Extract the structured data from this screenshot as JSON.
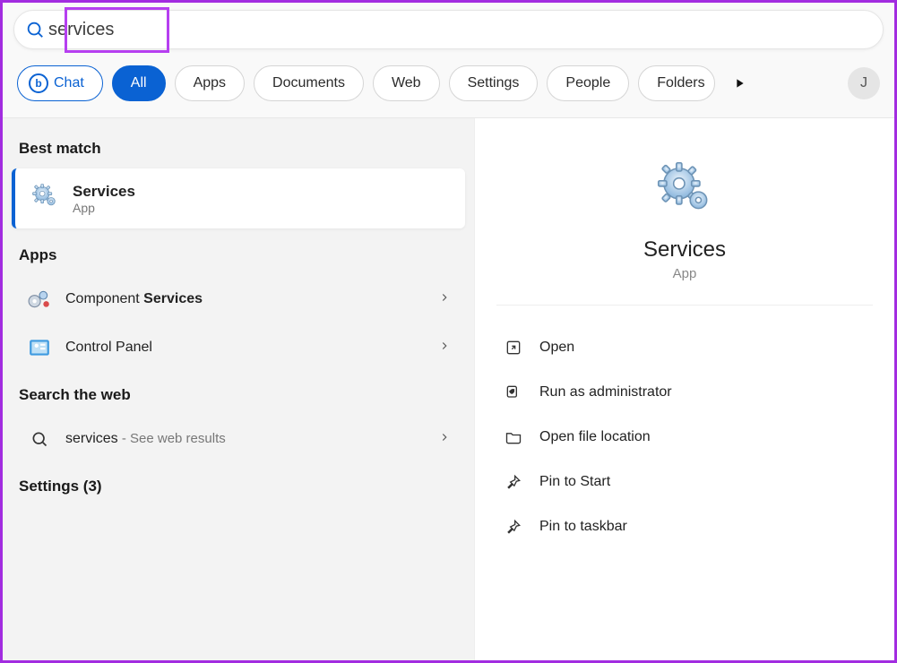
{
  "search": {
    "value": "services"
  },
  "filters": {
    "chat": "Chat",
    "all": "All",
    "apps": "Apps",
    "documents": "Documents",
    "web": "Web",
    "settings": "Settings",
    "people": "People",
    "folders": "Folders"
  },
  "avatar_initial": "J",
  "left": {
    "best_match_header": "Best match",
    "best_match": {
      "title": "Services",
      "subtitle": "App"
    },
    "apps_header": "Apps",
    "app_results": [
      {
        "pre": "Component ",
        "bold": "Services"
      },
      {
        "pre": "Control Panel",
        "bold": ""
      }
    ],
    "web_header": "Search the web",
    "web_results": [
      {
        "term": "services",
        "hint": " - See web results"
      }
    ],
    "settings_header": "Settings (3)"
  },
  "right": {
    "title": "Services",
    "subtitle": "App",
    "actions": {
      "open": "Open",
      "admin": "Run as administrator",
      "location": "Open file location",
      "pin_start": "Pin to Start",
      "pin_taskbar": "Pin to taskbar"
    }
  }
}
